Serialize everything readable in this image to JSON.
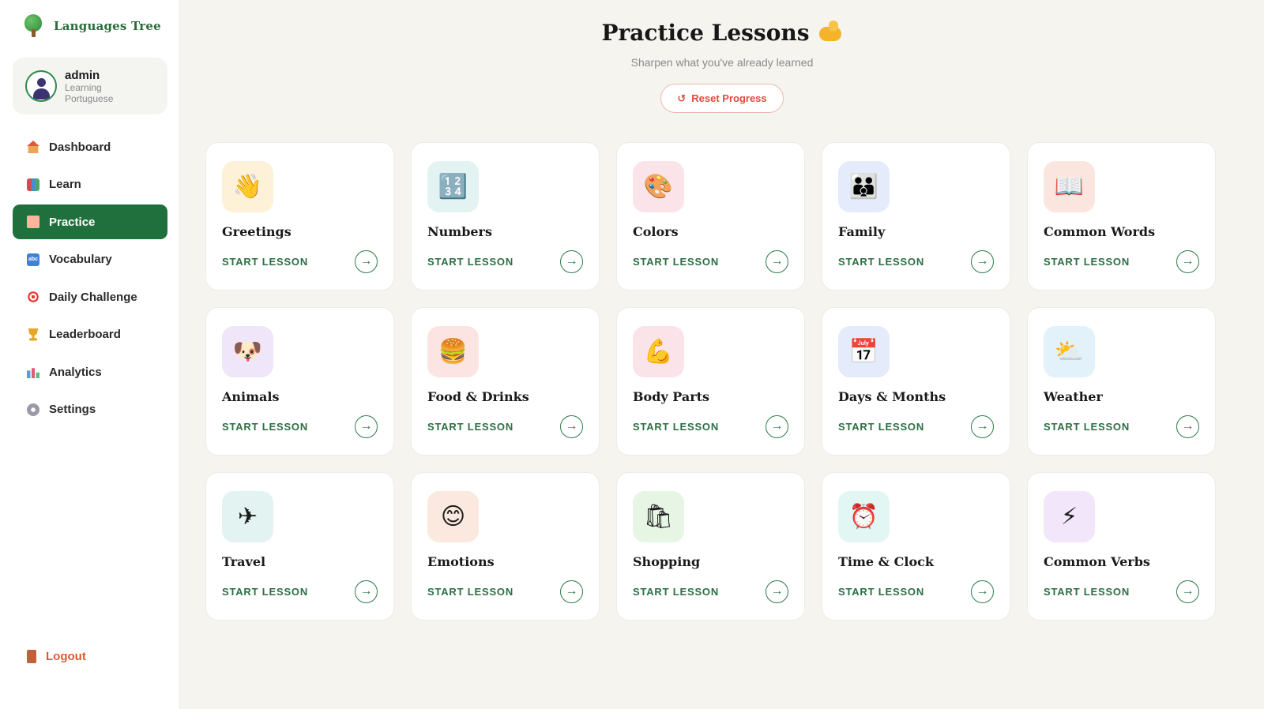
{
  "app": {
    "name": "Languages Tree"
  },
  "profile": {
    "username": "admin",
    "status": "Learning Portuguese"
  },
  "sidebar": {
    "items": [
      {
        "label": "Dashboard",
        "icon": "house-icon",
        "active": false
      },
      {
        "label": "Learn",
        "icon": "books-icon",
        "active": false
      },
      {
        "label": "Practice",
        "icon": "memo-icon",
        "active": true
      },
      {
        "label": "Vocabulary",
        "icon": "abc-icon",
        "active": false
      },
      {
        "label": "Daily Challenge",
        "icon": "target-icon",
        "active": false
      },
      {
        "label": "Leaderboard",
        "icon": "trophy-icon",
        "active": false
      },
      {
        "label": "Analytics",
        "icon": "bar-chart-icon",
        "active": false
      },
      {
        "label": "Settings",
        "icon": "gear-icon",
        "active": false
      }
    ],
    "logout_label": "Logout"
  },
  "page": {
    "title": "Practice Lessons",
    "title_emoji": "flexed-biceps-icon",
    "subtitle": "Sharpen what you've already learned",
    "reset_button": "Reset Progress"
  },
  "colors": {
    "accent_green": "#20703e",
    "reset_red": "#e14a3c",
    "background": "#f5f4ef"
  },
  "lessons": [
    {
      "title": "Greetings",
      "cta": "START LESSON",
      "icon": "waving-hand-icon",
      "glyph": "👋",
      "bg": "#fdf1d8"
    },
    {
      "title": "Numbers",
      "cta": "START LESSON",
      "icon": "numbers-keycap-icon",
      "glyph": "🔢",
      "bg": "#e2f3f1"
    },
    {
      "title": "Colors",
      "cta": "START LESSON",
      "icon": "palette-icon",
      "glyph": "🎨",
      "bg": "#fbe3ea"
    },
    {
      "title": "Family",
      "cta": "START LESSON",
      "icon": "family-icon",
      "glyph": "👪",
      "bg": "#e4ebfa"
    },
    {
      "title": "Common Words",
      "cta": "START LESSON",
      "icon": "open-book-icon",
      "glyph": "📖",
      "bg": "#fbe6df"
    },
    {
      "title": "Animals",
      "cta": "START LESSON",
      "icon": "dog-face-icon",
      "glyph": "🐶",
      "bg": "#efe6fa"
    },
    {
      "title": "Food & Drinks",
      "cta": "START LESSON",
      "icon": "hamburger-icon",
      "glyph": "🍔",
      "bg": "#fbe4e2"
    },
    {
      "title": "Body Parts",
      "cta": "START LESSON",
      "icon": "flexed-biceps-icon",
      "glyph": "💪",
      "bg": "#fbe3ea"
    },
    {
      "title": "Days & Months",
      "cta": "START LESSON",
      "icon": "calendar-icon",
      "glyph": "📅",
      "bg": "#e4ebfa"
    },
    {
      "title": "Weather",
      "cta": "START LESSON",
      "icon": "sun-behind-cloud-icon",
      "glyph": "⛅",
      "bg": "#e2f1fa"
    },
    {
      "title": "Travel",
      "cta": "START LESSON",
      "icon": "airplane-icon",
      "glyph": "✈",
      "bg": "#e2f3f1"
    },
    {
      "title": "Emotions",
      "cta": "START LESSON",
      "icon": "smiling-face-icon",
      "glyph": "😊",
      "bg": "#fbe9df"
    },
    {
      "title": "Shopping",
      "cta": "START LESSON",
      "icon": "shopping-bags-icon",
      "glyph": "🛍",
      "bg": "#e6f5e4"
    },
    {
      "title": "Time & Clock",
      "cta": "START LESSON",
      "icon": "alarm-clock-icon",
      "glyph": "⏰",
      "bg": "#e2f6f3"
    },
    {
      "title": "Common Verbs",
      "cta": "START LESSON",
      "icon": "lightning-icon",
      "glyph": "⚡",
      "bg": "#f1e6fa"
    }
  ]
}
